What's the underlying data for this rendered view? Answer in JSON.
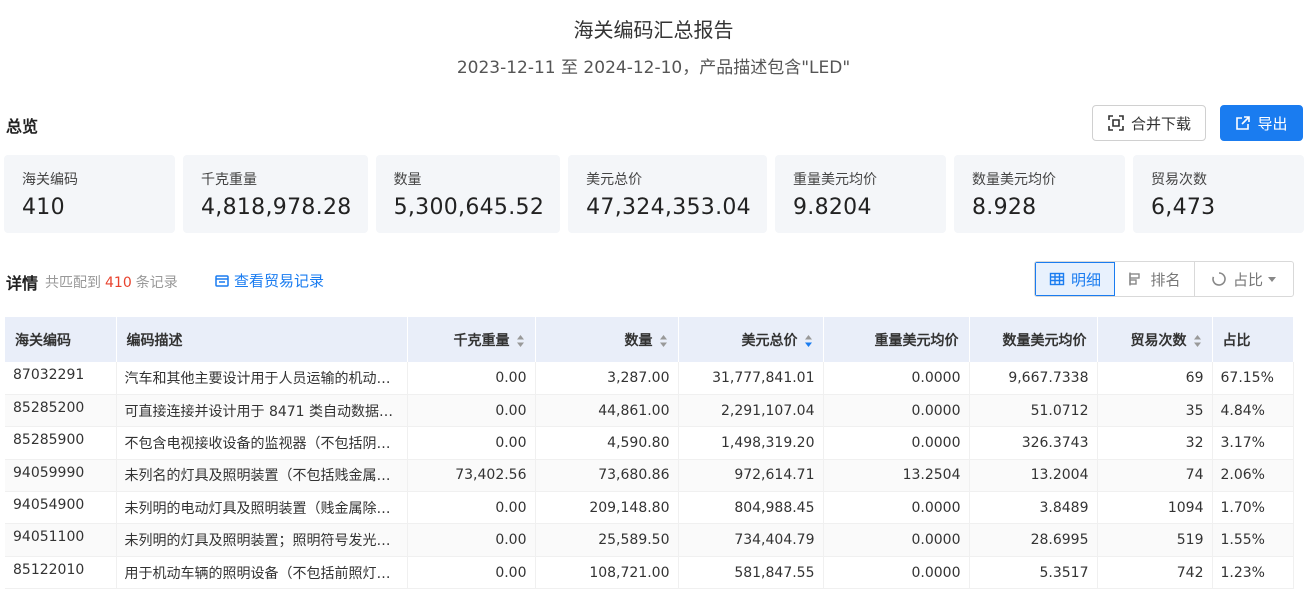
{
  "header": {
    "title": "海关编码汇总报告",
    "subtitle": "2023-12-11 至 2024-12-10，产品描述包含\"LED\""
  },
  "overview": {
    "label": "总览",
    "merge_download": "合并下载",
    "export": "导出",
    "cards": [
      {
        "label": "海关编码",
        "value": "410"
      },
      {
        "label": "千克重量",
        "value": "4,818,978.28"
      },
      {
        "label": "数量",
        "value": "5,300,645.52"
      },
      {
        "label": "美元总价",
        "value": "47,324,353.04"
      },
      {
        "label": "重量美元均价",
        "value": "9.8204"
      },
      {
        "label": "数量美元均价",
        "value": "8.928"
      },
      {
        "label": "贸易次数",
        "value": "6,473"
      }
    ]
  },
  "detail": {
    "label": "详情",
    "match_prefix": "共匹配到",
    "match_count": "410",
    "match_suffix": "条记录",
    "view_trade": "查看贸易记录",
    "views": {
      "detail": "明细",
      "rank": "排名",
      "share": "占比"
    }
  },
  "table": {
    "headers": {
      "code": "海关编码",
      "desc": "编码描述",
      "weight": "千克重量",
      "qty": "数量",
      "usd": "美元总价",
      "wavg": "重量美元均价",
      "qavg": "数量美元均价",
      "trades": "贸易次数",
      "share": "占比"
    },
    "rows": [
      {
        "code": "87032291",
        "desc": "汽车和其他主要设计用于人员运输的机动车...",
        "weight": "0.00",
        "qty": "3,287.00",
        "usd": "31,777,841.01",
        "wavg": "0.0000",
        "qavg": "9,667.7338",
        "trades": "69",
        "share": "67.15%"
      },
      {
        "code": "85285200",
        "desc": "可直接连接并设计用于 8471 类自动数据处...",
        "weight": "0.00",
        "qty": "44,861.00",
        "usd": "2,291,107.04",
        "wavg": "0.0000",
        "qavg": "51.0712",
        "trades": "35",
        "share": "4.84%"
      },
      {
        "code": "85285900",
        "desc": "不包含电视接收设备的监视器（不包括阴极...",
        "weight": "0.00",
        "qty": "4,590.80",
        "usd": "1,498,319.20",
        "wavg": "0.0000",
        "qavg": "326.3743",
        "trades": "32",
        "share": "3.17%"
      },
      {
        "code": "94059990",
        "desc": "未列名的灯具及照明装置（不包括贱金属零...",
        "weight": "73,402.56",
        "qty": "73,680.86",
        "usd": "972,614.71",
        "wavg": "13.2504",
        "qavg": "13.2004",
        "trades": "74",
        "share": "2.06%"
      },
      {
        "code": "94054900",
        "desc": "未列明的电动灯具及照明装置（贱金属除外）",
        "weight": "0.00",
        "qty": "209,148.80",
        "usd": "804,988.45",
        "wavg": "0.0000",
        "qavg": "3.8489",
        "trades": "1094",
        "share": "1.70%"
      },
      {
        "code": "94051100",
        "desc": "未列明的灯具及照明装置；照明符号发光板...",
        "weight": "0.00",
        "qty": "25,589.50",
        "usd": "734,404.79",
        "wavg": "0.0000",
        "qavg": "28.6995",
        "trades": "519",
        "share": "1.55%"
      },
      {
        "code": "85122010",
        "desc": "用于机动车辆的照明设备（不包括前照灯组）",
        "weight": "0.00",
        "qty": "108,721.00",
        "usd": "581,847.55",
        "wavg": "0.0000",
        "qavg": "5.3517",
        "trades": "742",
        "share": "1.23%"
      }
    ]
  }
}
